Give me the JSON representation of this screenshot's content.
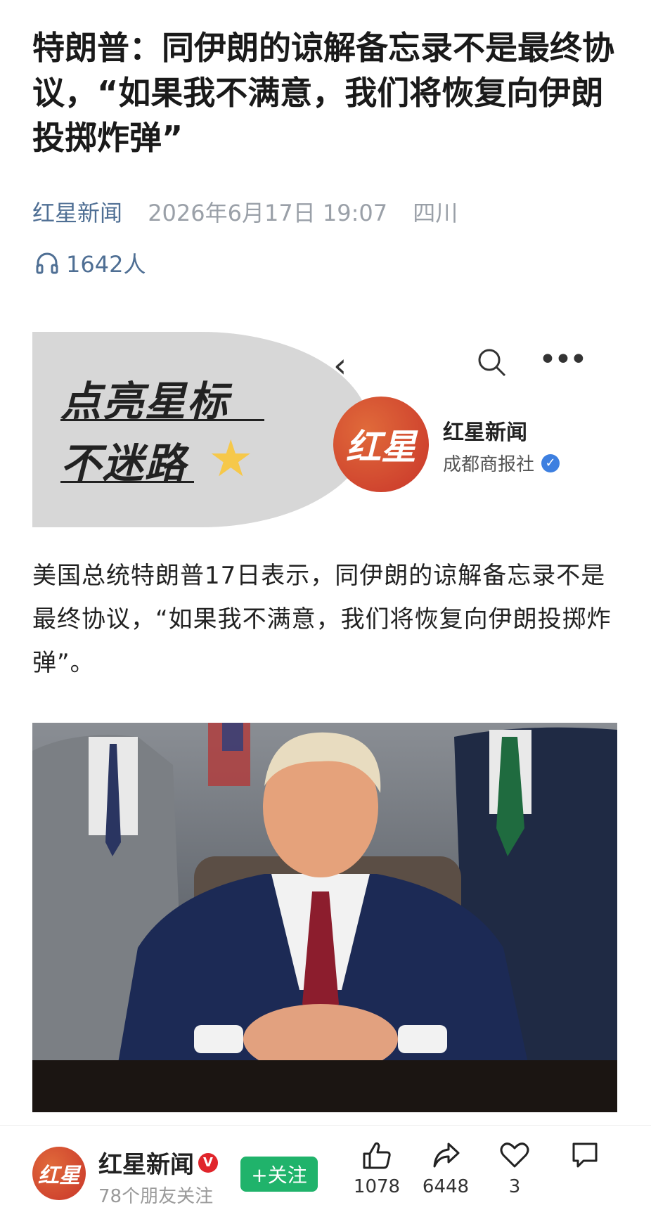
{
  "article": {
    "title": "特朗普：同伊朗的谅解备忘录不是最终协议，“如果我不满意，我们将恢复向伊朗投掷炸弹”",
    "source": "红星新闻",
    "date": "2026年6月17日 19:07",
    "location": "四川",
    "listeners": "1642人",
    "body": "美国总统特朗普17日表示，同伊朗的谅解备忘录不是最终协议，“如果我不满意，我们将恢复向伊朗投掷炸弹”。"
  },
  "banner": {
    "slogan_line1": "点亮星标",
    "slogan_line2": "不迷路",
    "logo_text": "红星",
    "account_name": "红星新闻",
    "account_org": "成都商报社"
  },
  "photo": {
    "icon": "news-photo"
  },
  "bottom_bar": {
    "logo_text": "红星",
    "account_name": "红星新闻",
    "verified_badge": "V",
    "friends_following": "78个朋友关注",
    "follow_label": "+关注",
    "likes": "1078",
    "shares": "6448",
    "favorites": "3",
    "colors": {
      "follow": "#20b36b",
      "brand": "#c9352a",
      "source_link": "#4f6f94"
    }
  }
}
